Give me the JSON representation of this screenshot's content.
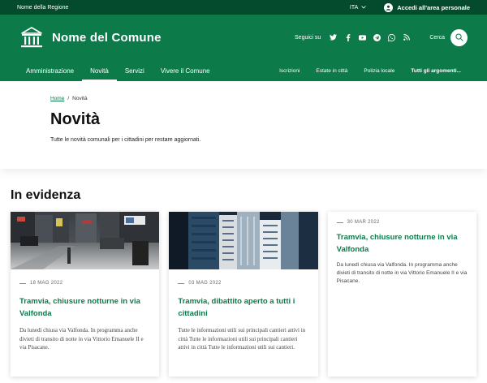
{
  "slim_header": {
    "region": "Nome della Regione",
    "language": "ITA",
    "login_label": "Accedi all'area personale"
  },
  "header": {
    "site_name": "Nome del Comune",
    "social_label": "Seguici su",
    "search_label": "Cerca"
  },
  "nav": {
    "main": [
      {
        "label": "Amministrazione",
        "active": false
      },
      {
        "label": "Novità",
        "active": true
      },
      {
        "label": "Servizi",
        "active": false
      },
      {
        "label": "Vivere il Comune",
        "active": false
      }
    ],
    "secondary": [
      {
        "label": "Iscrizioni"
      },
      {
        "label": "Estate in città"
      },
      {
        "label": "Polizia locale"
      },
      {
        "label": "Tutti gli argomenti..."
      }
    ]
  },
  "page": {
    "breadcrumb_home": "Home",
    "breadcrumb_sep": "/",
    "breadcrumb_current": "Novità",
    "title": "Novità",
    "subtitle": "Tutte le novità comunali per i cittadini per restare aggiornati."
  },
  "evidence": {
    "heading": "In evidenza",
    "cards": [
      {
        "date": "18 MAG 2022",
        "title": "Tramvia, chiusure notturne in via Valfonda",
        "description": "Da lunedì chiusa via Valfonda. In programma anche divieti di transito di notte in via Vittorio Emanuele II e via Pisacane."
      },
      {
        "date": "03 MAG 2022",
        "title": "Tramvia, dibattito aperto a tutti i cittadini",
        "description": "Tutte le informazioni utili sui principali cantieri attivi in città Tutte le informazioni utili sui principali cantieri attivi in città Tutte le informazioni utili sui cantieri."
      },
      {
        "date": "30 MAR 2022",
        "title": "Tramvia, chiusure notturne in via Valfonda",
        "description": "Da lunedì chiusa via Valfonda. In programma anche divieti di transito di notte in via Vittorio Emanuele II e via Pisacane."
      }
    ]
  },
  "icons": {
    "twitter": "twitter-icon",
    "facebook": "facebook-icon",
    "youtube": "youtube-icon",
    "telegram": "telegram-icon",
    "whatsapp": "whatsapp-icon",
    "rss": "rss-icon"
  },
  "colors": {
    "primary": "#0d7a4a",
    "dark": "#044a2c"
  }
}
